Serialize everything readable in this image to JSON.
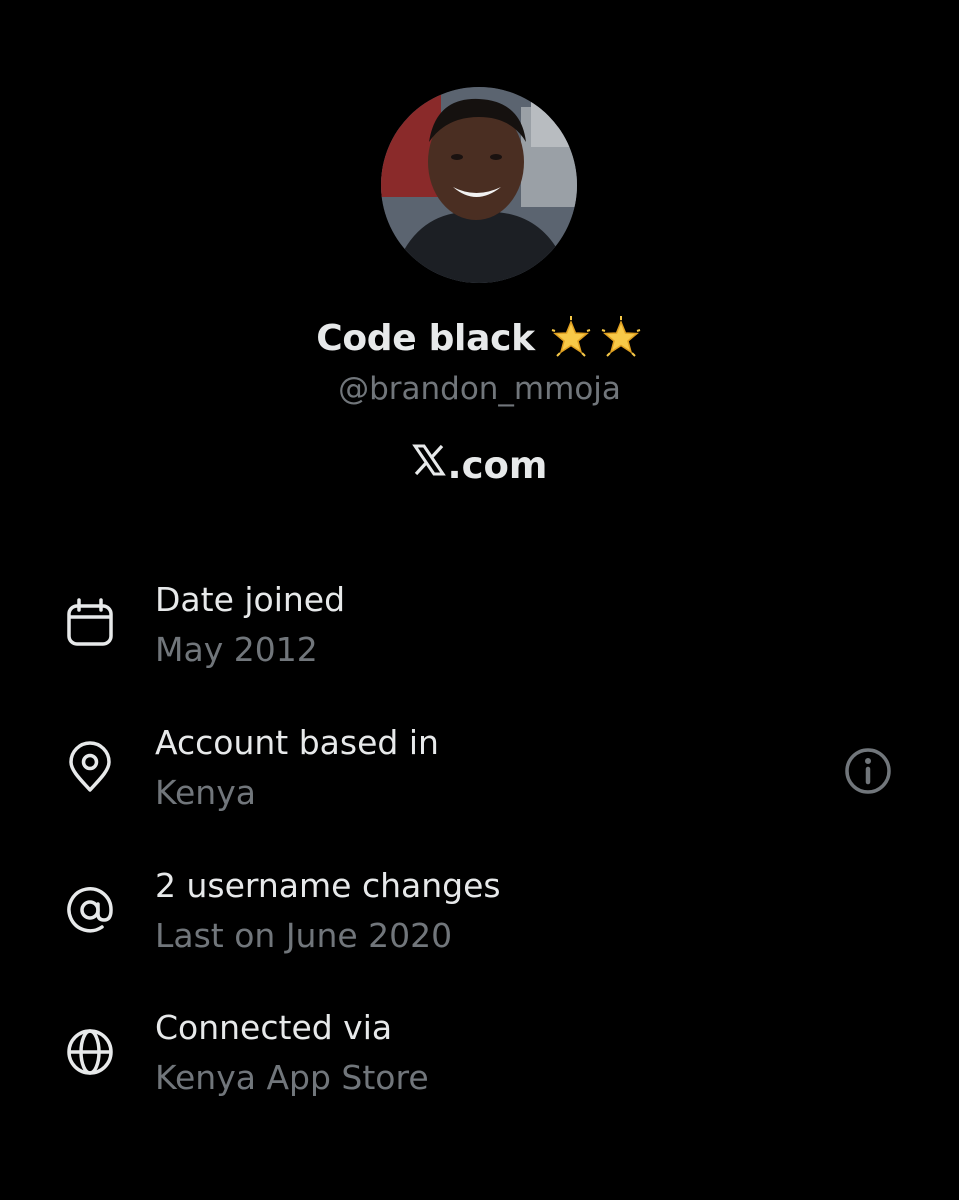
{
  "profile": {
    "display_name": "Code black",
    "badge_icons": [
      "glowing-star-icon",
      "glowing-star-icon"
    ],
    "handle": "@brandon_mmoja",
    "site_suffix": ".com",
    "site_logo_icon": "x-logo-icon"
  },
  "details": [
    {
      "icon": "calendar-icon",
      "label": "Date joined",
      "value": "May 2012"
    },
    {
      "icon": "location-pin-icon",
      "label": "Account based in",
      "value": "Kenya"
    },
    {
      "icon": "at-sign-icon",
      "label": "2 username changes",
      "value": "Last on June 2020"
    },
    {
      "icon": "globe-icon",
      "label": "Connected via",
      "value": "Kenya App Store"
    }
  ],
  "info_button_icon": "info-icon",
  "colors": {
    "background": "#000000",
    "primary_text": "#e7e9ea",
    "secondary_text": "#71767b",
    "star": "#f7c948"
  }
}
